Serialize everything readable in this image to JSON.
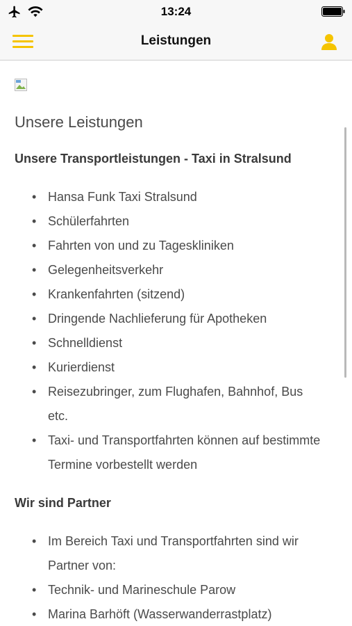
{
  "status_bar": {
    "time": "13:24"
  },
  "nav": {
    "title": "Leistungen"
  },
  "content": {
    "page_heading": "Unsere Leistungen",
    "section1": {
      "heading": "Unsere Transportleistungen - Taxi in Stralsund",
      "items": [
        "Hansa Funk Taxi Stralsund",
        "Schülerfahrten",
        "Fahrten von und zu Tageskliniken",
        "Gelegenheitsverkehr",
        "Krankenfahrten (sitzend)",
        "Dringende Nachlieferung für Apotheken",
        "Schnelldienst",
        "Kurierdienst",
        "Reisezubringer, zum Flughafen, Bahnhof, Bus etc.",
        "Taxi- und Transportfahrten können auf bestimmte Termine vorbestellt werden"
      ]
    },
    "section2": {
      "heading": "Wir sind Partner",
      "items": [
        "Im Bereich Taxi und Transportfahrten sind wir Partner von:",
        "Technik- und Marineschule Parow",
        "Marina Barhöft (Wasserwanderrastplatz)"
      ]
    }
  },
  "colors": {
    "accent": "#f5c400",
    "bar_bg": "#f7f7f7",
    "text": "#4a4a4a"
  },
  "icons": [
    "airplane-icon",
    "wifi-icon",
    "battery-icon",
    "hamburger-menu-icon",
    "user-icon",
    "broken-image-icon"
  ]
}
